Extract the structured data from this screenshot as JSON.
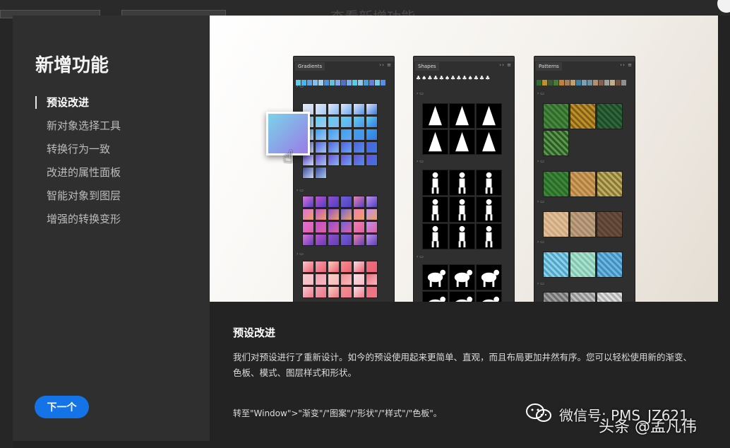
{
  "background": {
    "title_fragment": "查看新增功能"
  },
  "dialog": {
    "title": "新增功能",
    "nav": [
      {
        "label": "预设改进",
        "active": true
      },
      {
        "label": "新对象选择工具",
        "active": false
      },
      {
        "label": "转换行为一致",
        "active": false
      },
      {
        "label": "改进的属性面板",
        "active": false
      },
      {
        "label": "智能对象到图层",
        "active": false
      },
      {
        "label": "增强的转换变形",
        "active": false
      }
    ],
    "next_button": "下一个",
    "panels": {
      "gradients": "Gradients",
      "shapes": "Shapes",
      "patterns": "Patterns"
    },
    "description": {
      "heading": "预设改进",
      "body": "我们对预设进行了重新设计。如今的预设使用起来更简单、直观，而且布局更加井然有序。您可以轻松使用新的渐变、色板、模式、图层样式和形状。",
      "goto": "转至\"Window\">\"渐变\"/\"图案\"/\"形状\"/\"样式\"/\"色板\"。"
    }
  },
  "watermark": {
    "line1": "微信号: PMS_JZ621",
    "line2": "头条 @孟凡伟"
  },
  "colors": {
    "accent": "#1473e6",
    "dialog_bg": "#2f2f2f",
    "desc_bg": "#232323"
  },
  "icons": {
    "panel_menu": "hamburger-icon",
    "drag_cursor": "hand-icon",
    "folder": "folder-icon"
  }
}
